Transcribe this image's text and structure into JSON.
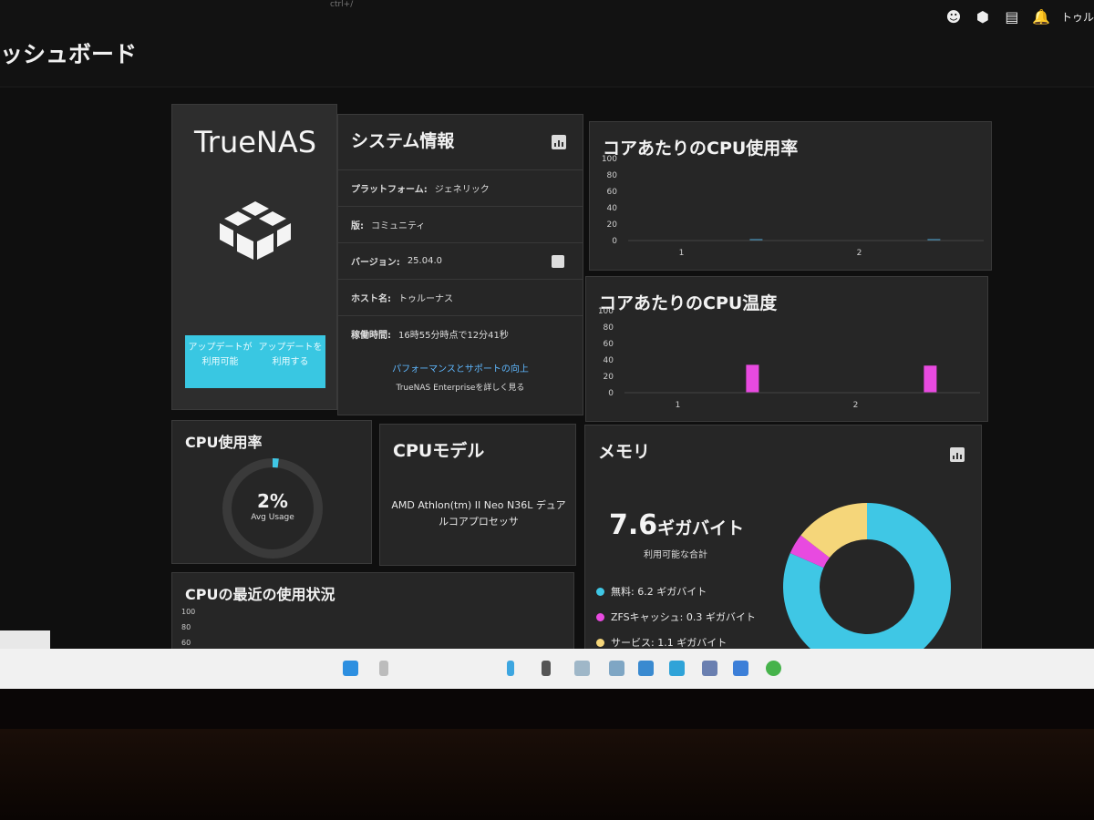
{
  "header": {
    "shortcut_hint": "ctrl+/",
    "page_title": "ッシュボード",
    "user_name": "トゥル"
  },
  "topbar_icons": [
    "smiley-icon",
    "truecommand-icon",
    "clipboard-icon",
    "bell-icon"
  ],
  "logo_card": {
    "brand": "TrueNAS",
    "update_button": {
      "left": "アップデートが利用可能",
      "right": "アップデートを利用する"
    }
  },
  "system_info": {
    "title": "システム情報",
    "rows": [
      {
        "label": "プラットフォーム:",
        "value": "ジェネリック"
      },
      {
        "label": "版:",
        "value": "コミュニティ"
      },
      {
        "label": "バージョン:",
        "value": "25.04.0"
      },
      {
        "label": "ホスト名:",
        "value": "トゥルーナス"
      },
      {
        "label": "稼働時間:",
        "value": "16時55分時点で12分41秒"
      }
    ],
    "promo_link": "パフォーマンスとサポートの向上",
    "promo_sub": "TrueNAS Enterpriseを詳しく見る"
  },
  "cpu_core_usage": {
    "title": "コアあたりのCPU使用率"
  },
  "cpu_core_temp": {
    "title": "コアあたりのCPU温度"
  },
  "cpu_usage": {
    "title": "CPU使用率",
    "value": "2%",
    "label": "Avg Usage",
    "percent": 2
  },
  "cpu_model": {
    "title": "CPUモデル",
    "model": "AMD Athlon(tm) II Neo N36L デュアルコアプロセッサ"
  },
  "memory": {
    "title": "メモリ",
    "total_value": "7.6",
    "total_unit": "ギガバイト",
    "total_label": "利用可能な合計",
    "legend": [
      {
        "label": "無料:",
        "value": "6.2 ギガバイト",
        "color": "#3fc7e5"
      },
      {
        "label": "ZFSキャッシュ:",
        "value": "0.3 ギガバイト",
        "color": "#e84ae0"
      },
      {
        "label": "サービス:",
        "value": "1.1 ギガバイト",
        "color": "#f5d67a"
      }
    ]
  },
  "recent_usage": {
    "title": "CPUの最近の使用状況",
    "axis_ticks": [
      "100",
      "80",
      "60"
    ]
  },
  "chart_data": [
    {
      "type": "bar",
      "title": "コアあたりのCPU使用率",
      "categories": [
        "1",
        "2"
      ],
      "yticks": [
        100,
        80,
        60,
        40,
        20,
        0
      ],
      "ylim": [
        0,
        100
      ],
      "values": [
        0,
        1
      ]
    },
    {
      "type": "bar",
      "title": "コアあたりのCPU温度",
      "categories": [
        "1",
        "2"
      ],
      "yticks": [
        100,
        80,
        60,
        40,
        20,
        0
      ],
      "ylim": [
        0,
        100
      ],
      "values": [
        34,
        33
      ]
    }
  ]
}
